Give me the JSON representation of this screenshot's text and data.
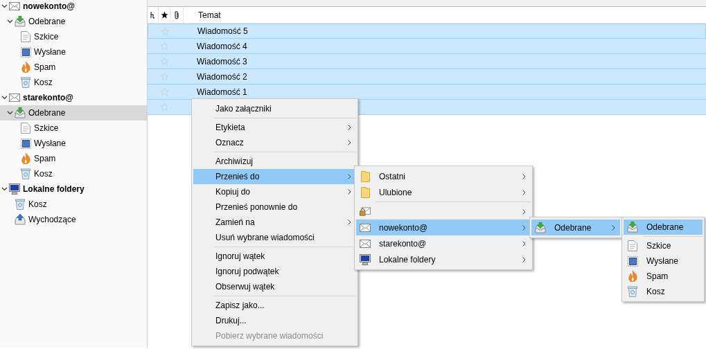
{
  "folder_tree": [
    {
      "label": "nowekonto@",
      "kind": "account",
      "selected": false,
      "expanded": true,
      "children": [
        {
          "label": "Odebrane",
          "kind": "inbox",
          "selected": false,
          "expanded": true,
          "children": [
            {
              "label": "Szkice",
              "kind": "drafts",
              "selected": false
            },
            {
              "label": "Wysłane",
              "kind": "sent",
              "selected": false
            },
            {
              "label": "Spam",
              "kind": "spam",
              "selected": false
            },
            {
              "label": "Kosz",
              "kind": "trash",
              "selected": false
            }
          ]
        }
      ]
    },
    {
      "label": "starekonto@",
      "kind": "account",
      "selected": false,
      "expanded": true,
      "children": [
        {
          "label": "Odebrane",
          "kind": "inbox",
          "selected": true,
          "expanded": true,
          "children": [
            {
              "label": "Szkice",
              "kind": "drafts",
              "selected": false
            },
            {
              "label": "Wysłane",
              "kind": "sent",
              "selected": false
            },
            {
              "label": "Spam",
              "kind": "spam",
              "selected": false
            },
            {
              "label": "Kosz",
              "kind": "trash",
              "selected": false
            }
          ]
        }
      ]
    },
    {
      "label": "Lokalne foldery",
      "kind": "local",
      "selected": false,
      "expanded": true,
      "children": [
        {
          "label": "Kosz",
          "kind": "trash",
          "selected": false
        },
        {
          "label": "Wychodzące",
          "kind": "outbox",
          "selected": false
        }
      ]
    }
  ],
  "message_list": {
    "columns": [
      {
        "kind": "thread"
      },
      {
        "kind": "star"
      },
      {
        "kind": "attachment"
      },
      {
        "kind": "text",
        "label": "Temat"
      }
    ],
    "rows": [
      {
        "subject": "Wiadomość 5",
        "starred": false,
        "selected": true
      },
      {
        "subject": "Wiadomość 4",
        "starred": false,
        "selected": true
      },
      {
        "subject": "Wiadomość 3",
        "starred": false,
        "selected": true
      },
      {
        "subject": "Wiadomość 2",
        "starred": false,
        "selected": true
      },
      {
        "subject": "Wiadomość 1",
        "starred": false,
        "selected": true
      },
      {
        "starred": false,
        "selected": true
      }
    ]
  },
  "context_menu": [
    {
      "kind": "item",
      "label": "Jako załączniki",
      "submenu": false,
      "selected": false,
      "disabled": false
    },
    {
      "kind": "separator"
    },
    {
      "kind": "item",
      "label": "Etykieta",
      "submenu": true,
      "selected": false,
      "disabled": false
    },
    {
      "kind": "item",
      "label": "Oznacz",
      "submenu": true,
      "selected": false,
      "disabled": false
    },
    {
      "kind": "separator"
    },
    {
      "kind": "item",
      "label": "Archiwizuj",
      "submenu": false,
      "selected": false,
      "disabled": false
    },
    {
      "kind": "item",
      "label": "Przenieś do",
      "submenu": true,
      "selected": true,
      "disabled": false
    },
    {
      "kind": "item",
      "label": "Kopiuj do",
      "submenu": true,
      "selected": false,
      "disabled": false
    },
    {
      "kind": "item",
      "label": "Przenieś ponownie do",
      "submenu": false,
      "selected": false,
      "disabled": false
    },
    {
      "kind": "item",
      "label": "Zamień na",
      "submenu": true,
      "selected": false,
      "disabled": false
    },
    {
      "kind": "item",
      "label": "Usuń wybrane wiadomości",
      "submenu": false,
      "selected": false,
      "disabled": false
    },
    {
      "kind": "separator"
    },
    {
      "kind": "item",
      "label": "Ignoruj wątek",
      "submenu": false,
      "selected": false,
      "disabled": false
    },
    {
      "kind": "item",
      "label": "Ignoruj podwątek",
      "submenu": false,
      "selected": false,
      "disabled": false
    },
    {
      "kind": "item",
      "label": "Obserwuj wątek",
      "submenu": false,
      "selected": false,
      "disabled": false
    },
    {
      "kind": "separator"
    },
    {
      "kind": "item",
      "label": "Zapisz jako...",
      "submenu": false,
      "selected": false,
      "disabled": false
    },
    {
      "kind": "item",
      "label": "Drukuj...",
      "submenu": false,
      "selected": false,
      "disabled": false
    },
    {
      "kind": "item",
      "label": "Pobierz wybrane wiadomości",
      "submenu": false,
      "selected": false,
      "disabled": true
    }
  ],
  "move_to_menu": [
    {
      "kind": "folder",
      "label": "Ostatni",
      "submenu": true,
      "selected": false
    },
    {
      "kind": "folder",
      "label": "Ulubione",
      "submenu": true,
      "selected": false
    },
    {
      "kind": "separator"
    },
    {
      "kind": "lock",
      "submenu": true,
      "selected": false
    },
    {
      "kind": "account",
      "label": "nowekonto@",
      "submenu": true,
      "selected": true
    },
    {
      "kind": "account",
      "label": "starekonto@",
      "submenu": true,
      "selected": false
    },
    {
      "kind": "local",
      "label": "Lokalne foldery",
      "submenu": true,
      "selected": false
    }
  ],
  "account_menu": [
    {
      "kind": "inbox",
      "label": "Odebrane",
      "submenu": true,
      "selected": true
    }
  ],
  "folder_menu": [
    {
      "kind": "inbox",
      "label": "Odebrane",
      "submenu": false,
      "selected": true
    },
    {
      "kind": "separator"
    },
    {
      "kind": "drafts",
      "label": "Szkice",
      "submenu": false,
      "selected": false
    },
    {
      "kind": "sent",
      "label": "Wysłane",
      "submenu": false,
      "selected": false
    },
    {
      "kind": "spam",
      "label": "Spam",
      "submenu": false,
      "selected": false
    },
    {
      "kind": "trash",
      "label": "Kosz",
      "submenu": false,
      "selected": false
    }
  ]
}
